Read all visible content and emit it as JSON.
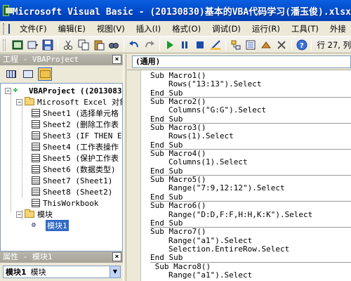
{
  "title": "Microsoft Visual Basic - (20130830)基本的VBA代码学习(潘玉俊).xlsx",
  "menu": [
    "文件(F)",
    "编辑(E)",
    "视图(V)",
    "插入(I)",
    "格式(O)",
    "调试(D)",
    "运行(R)",
    "工具(T)",
    "外接"
  ],
  "toolbar": {
    "position": "行 27, 列"
  },
  "project_pane": {
    "title": "工程 - VBAProject",
    "close": "×",
    "root": "VBAProject ((20130830",
    "excel_folder": "Microsoft Excel 对象",
    "sheets": [
      "Sheet1 (选择单元格",
      "Sheet2 (删除工作表",
      "Sheet3 (IF THEN E",
      "Sheet4 (工作表操作",
      "Sheet5 (保护工作表",
      "Sheet6 (数据类型)",
      "Sheet7 (Sheet1)",
      "Sheet8 (Sheet2)",
      "ThisWorkbook"
    ],
    "module_folder": "模块",
    "module": "模块1"
  },
  "properties": {
    "title": "属性 - 模块1",
    "object": "模块1",
    "type": "模块"
  },
  "code_window": {
    "combo": "(通用)",
    "blocks": [
      [
        "Sub Macro1()",
        "Rows(\"13:13\").Select",
        "End Sub"
      ],
      [
        "Sub Macro2()",
        "Columns(\"G:G\").Select",
        "End Sub"
      ],
      [
        "Sub Macro3()",
        "Rows(1).Select",
        "End Sub"
      ],
      [
        "Sub Macro4()",
        "Columns(1).Select",
        "End Sub"
      ],
      [
        "Sub Macro5()",
        "Range(\"7:9,12:12\").Select",
        "End Sub"
      ],
      [
        "Sub Macro6()",
        "Range(\"D:D,F:F,H:H,K:K\").Select",
        "End Sub"
      ],
      [
        "Sub Macro7()",
        "Range(\"a1\").Select",
        "Selection.EntireRow.Select",
        "End Sub"
      ],
      [
        " Sub Macro8()",
        "Range(\"a1\").Select"
      ]
    ]
  }
}
